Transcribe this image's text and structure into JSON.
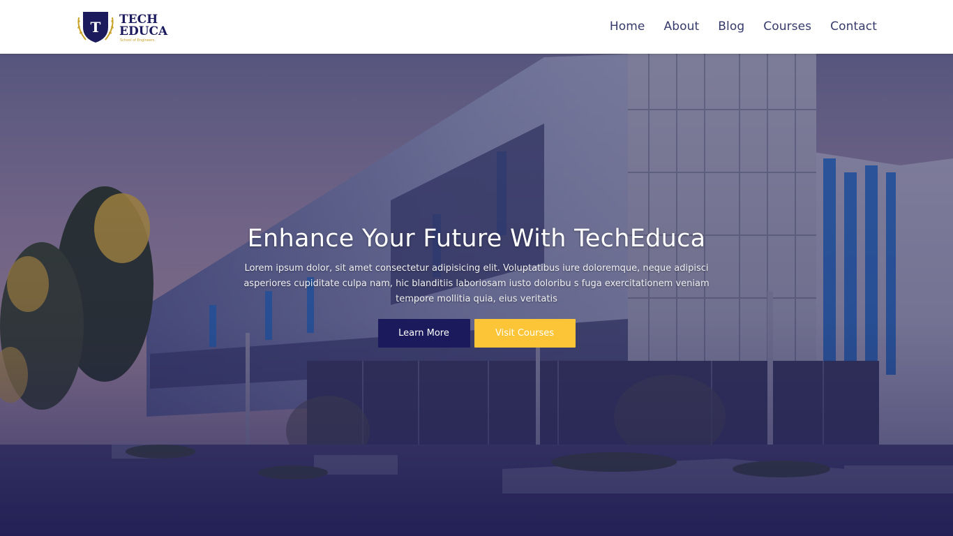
{
  "brand": {
    "name_line1": "TECH",
    "name_line2": "EDUCA",
    "tagline": "School of Engineers",
    "crest_letter": "T"
  },
  "nav": {
    "items": [
      {
        "label": "Home"
      },
      {
        "label": "About"
      },
      {
        "label": "Blog"
      },
      {
        "label": "Courses"
      },
      {
        "label": "Contact"
      }
    ]
  },
  "hero": {
    "title": "Enhance Your Future With TechEduca",
    "text": "Lorem ipsum dolor, sit amet consectetur adipisicing elit. Voluptatibus iure doloremque, neque adipisci asperiores cupiditate culpa nam, hic blanditiis laboriosam iusto doloribu s fuga exercitationem veniam tempore mollitia quia, eius veritatis",
    "primary_button": "Learn More",
    "secondary_button": "Visit Courses"
  },
  "colors": {
    "brand_navy": "#1b1a5c",
    "accent_yellow": "#fbc537",
    "nav_text": "#353a6b"
  }
}
